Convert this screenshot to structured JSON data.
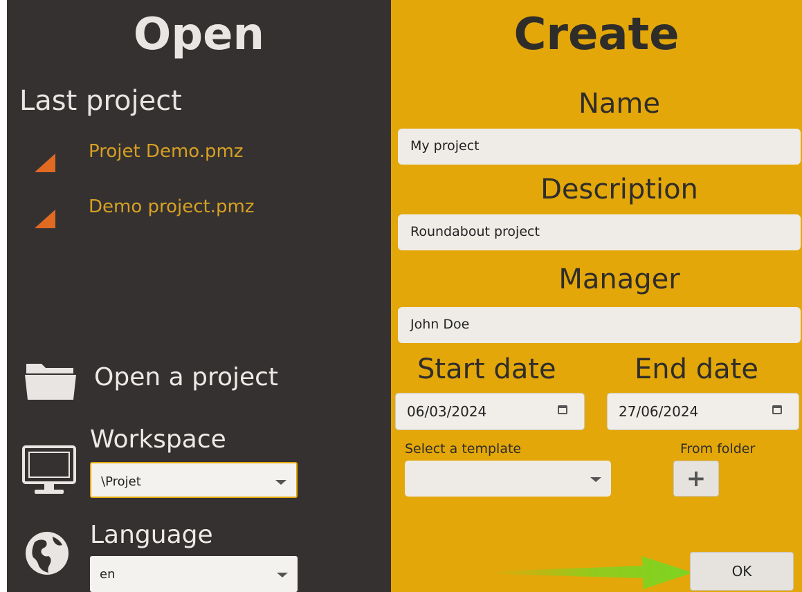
{
  "open_panel": {
    "title": "Open",
    "last_project_label": "Last project",
    "recent_files": [
      {
        "name": "Projet Demo.pmz",
        "icon": "pmz-file-icon"
      },
      {
        "name": "Demo project.pmz",
        "icon": "pmz-file-icon"
      }
    ],
    "open_project_label": "Open a project",
    "workspace": {
      "label": "Workspace",
      "value": "\\Projet"
    },
    "language": {
      "label": "Language",
      "value": "en"
    }
  },
  "create_panel": {
    "title": "Create",
    "name": {
      "label": "Name",
      "value": "My project"
    },
    "description": {
      "label": "Description",
      "value": "Roundabout project"
    },
    "manager": {
      "label": "Manager",
      "value": "John Doe"
    },
    "start_date": {
      "label": "Start date",
      "value": "06/03/2024"
    },
    "end_date": {
      "label": "End date",
      "value": "27/06/2024"
    },
    "template": {
      "label": "Select a template",
      "value": ""
    },
    "from_folder_label": "From folder",
    "add_icon": "+",
    "ok_label": "OK"
  },
  "colors": {
    "left_bg": "#353130",
    "right_bg": "#e3a70a",
    "link": "#d6a023",
    "file_icon": "#e06a22",
    "arrow": "#7ed321"
  }
}
